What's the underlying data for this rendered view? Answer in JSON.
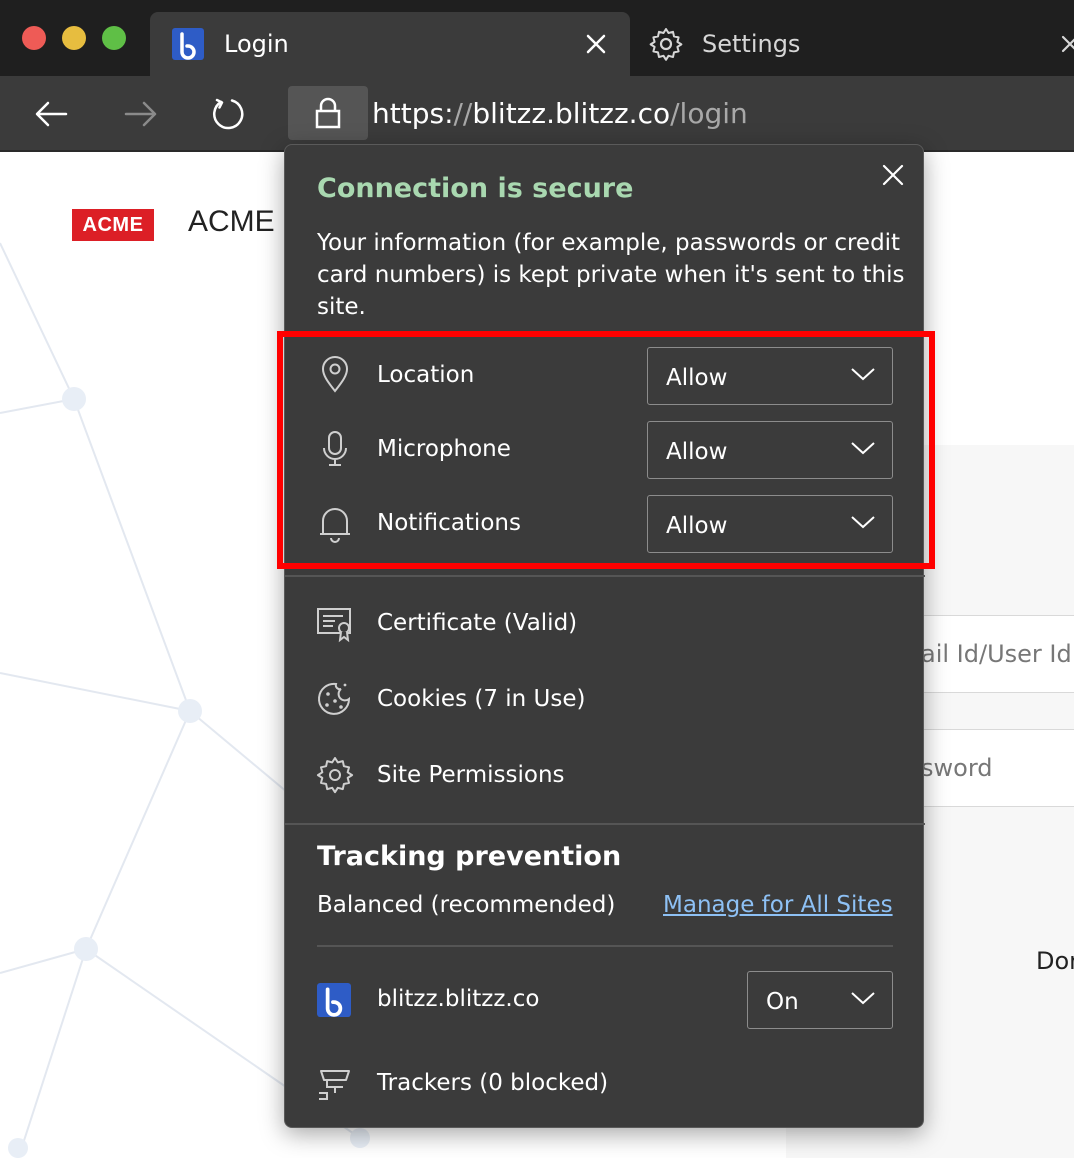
{
  "window": {
    "active_tab": {
      "title": "Login",
      "favicon": "blitzz-logo-icon"
    },
    "inactive_tab": {
      "title": "Settings",
      "icon": "gear-icon"
    }
  },
  "address_bar": {
    "scheme": "https://",
    "host": "blitzz.blitzz.co",
    "path": "/login",
    "lock_icon": "lock-icon"
  },
  "page": {
    "logo_text": "ACME",
    "brand_name": "ACME",
    "username_placeholder_visible": "ail Id/User Id",
    "password_placeholder_visible": "sword",
    "partial_text": "Dor"
  },
  "popup": {
    "title": "Connection is secure",
    "description": "Your information (for example, passwords or credit card numbers) is kept private when it's sent to this site.",
    "permissions": [
      {
        "label": "Location",
        "value": "Allow",
        "icon": "location-pin-icon"
      },
      {
        "label": "Microphone",
        "value": "Allow",
        "icon": "microphone-icon"
      },
      {
        "label": "Notifications",
        "value": "Allow",
        "icon": "bell-icon"
      }
    ],
    "info_items": [
      {
        "label": "Certificate (Valid)",
        "icon": "certificate-icon"
      },
      {
        "label": "Cookies (7 in Use)",
        "icon": "cookie-icon"
      },
      {
        "label": "Site Permissions",
        "icon": "gear-icon"
      }
    ],
    "tracking": {
      "title": "Tracking prevention",
      "level": "Balanced (recommended)",
      "manage_link": "Manage for All Sites",
      "site": "blitzz.blitzz.co",
      "site_value": "On",
      "trackers": "Trackers (0 blocked)"
    }
  },
  "colors": {
    "popup_bg": "#3b3b3b",
    "secure_title": "#a9d8b0",
    "link": "#8ec1f5",
    "highlight": "#ff0000",
    "acme_red": "#dc1f26"
  }
}
